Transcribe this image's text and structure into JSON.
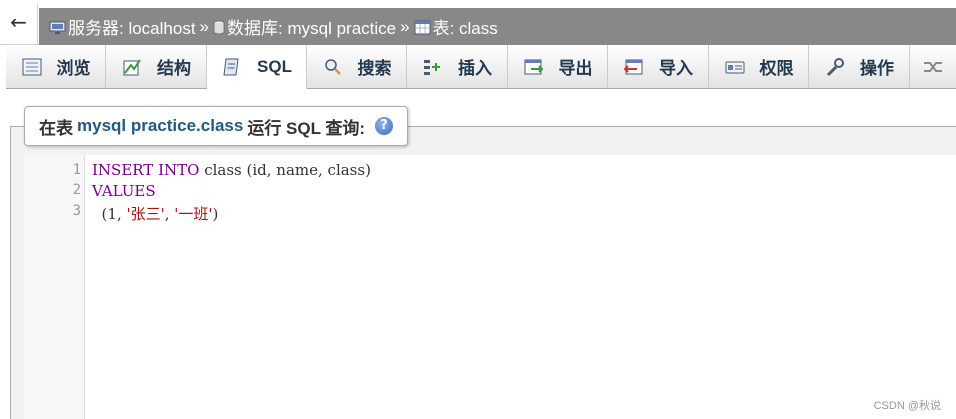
{
  "breadcrumb": {
    "back": "←",
    "server_label": "服务器: localhost",
    "sep1": "»",
    "database_label": "数据库: mysql practice",
    "sep2": "»",
    "table_label": "表: class"
  },
  "tabs": [
    {
      "label": "浏览",
      "icon": "browse-icon",
      "active": false
    },
    {
      "label": "结构",
      "icon": "structure-icon",
      "active": false
    },
    {
      "label": "SQL",
      "icon": "sql-icon",
      "active": true
    },
    {
      "label": "搜索",
      "icon": "search-icon",
      "active": false
    },
    {
      "label": "插入",
      "icon": "insert-icon",
      "active": false
    },
    {
      "label": "导出",
      "icon": "export-icon",
      "active": false
    },
    {
      "label": "导入",
      "icon": "import-icon",
      "active": false
    },
    {
      "label": "权限",
      "icon": "privileges-icon",
      "active": false
    },
    {
      "label": "操作",
      "icon": "operations-icon",
      "active": false
    },
    {
      "label": "",
      "icon": "more-icon",
      "active": false
    }
  ],
  "query_panel": {
    "prefix": "在表",
    "db_table": "mysql practice.class",
    "suffix": "运行 SQL 查询:"
  },
  "editor": {
    "line_numbers": [
      "1",
      "2",
      "3"
    ],
    "line1": {
      "kw1": "INSERT INTO",
      "rest": " class (id, name, class)"
    },
    "line2": {
      "kw1": "VALUES"
    },
    "line3": {
      "indent": "  ",
      "p1": "(1, ",
      "s1": "'张三'",
      "p2": ", ",
      "s2": "'一班'",
      "p3": ")"
    }
  },
  "watermark": "CSDN @秋说",
  "colors": {
    "keyword": "#770088",
    "string": "#aa1111",
    "link": "#235a81",
    "breadcrumb_bg": "#888888"
  }
}
